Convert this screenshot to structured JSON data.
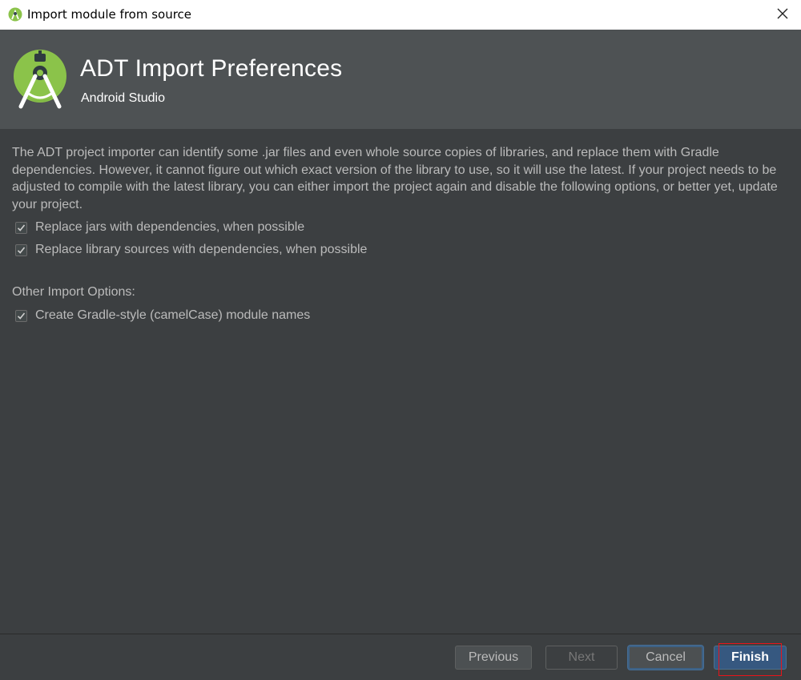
{
  "window": {
    "title": "Import module from source",
    "app_icon": "android-studio-icon",
    "close_icon": "close-icon"
  },
  "header": {
    "title": "ADT Import Preferences",
    "subtitle": "Android Studio",
    "logo": "android-studio-logo"
  },
  "content": {
    "description": "The ADT project importer can identify some .jar files and even whole source copies of libraries, and replace them with Gradle dependencies. However, it cannot figure out which exact version of the library to use, so it will use the latest. If your project needs to be adjusted to compile with the latest library, you can either import the project again and disable the following options, or better yet, update your project.",
    "options": [
      {
        "label": "Replace jars with dependencies, when possible",
        "checked": true
      },
      {
        "label": "Replace library sources with dependencies, when possible",
        "checked": true
      }
    ],
    "other_section_label": "Other Import Options:",
    "other_options": [
      {
        "label": "Create Gradle-style (camelCase) module names",
        "checked": true
      }
    ]
  },
  "footer": {
    "previous_label": "Previous",
    "next_label": "Next",
    "cancel_label": "Cancel",
    "finish_label": "Finish"
  },
  "colors": {
    "header_bg": "#4e5254",
    "content_bg": "#3c3f41",
    "text": "#bbbbbb",
    "finish_button_bg": "#365880",
    "annotation_red": "#e8141a",
    "android_green": "#8bc34a"
  }
}
